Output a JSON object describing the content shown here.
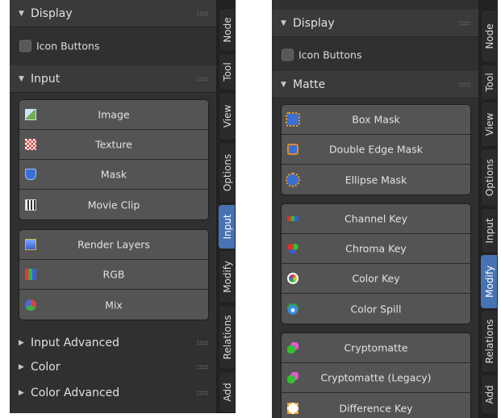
{
  "left": {
    "display_header": "Display",
    "icon_buttons_label": "Icon Buttons",
    "input_header": "Input",
    "group1": [
      {
        "label": "Image",
        "icon": "image-icon"
      },
      {
        "label": "Texture",
        "icon": "texture-icon"
      },
      {
        "label": "Mask",
        "icon": "mask-icon"
      },
      {
        "label": "Movie Clip",
        "icon": "movie-clip-icon"
      }
    ],
    "group2": [
      {
        "label": "Render Layers",
        "icon": "render-layers-icon"
      },
      {
        "label": "RGB",
        "icon": "rgb-icon"
      },
      {
        "label": "Mix",
        "icon": "mix-icon"
      }
    ],
    "collapsed": [
      "Input Advanced",
      "Color",
      "Color Advanced"
    ],
    "tabs": [
      "Node",
      "Tool",
      "View",
      "Options",
      "Input",
      "Modify",
      "Relations",
      "Add"
    ],
    "active_tab": "Input"
  },
  "right": {
    "display_header": "Display",
    "icon_buttons_label": "Icon Buttons",
    "matte_header": "Matte",
    "group1": [
      {
        "label": "Box Mask",
        "icon": "box-mask-icon"
      },
      {
        "label": "Double Edge Mask",
        "icon": "double-edge-mask-icon"
      },
      {
        "label": "Ellipse Mask",
        "icon": "ellipse-mask-icon"
      }
    ],
    "group2": [
      {
        "label": "Channel Key",
        "icon": "channel-key-icon"
      },
      {
        "label": "Chroma Key",
        "icon": "chroma-key-icon"
      },
      {
        "label": "Color Key",
        "icon": "color-key-icon"
      },
      {
        "label": "Color Spill",
        "icon": "color-spill-icon"
      }
    ],
    "group3": [
      {
        "label": "Cryptomatte",
        "icon": "cryptomatte-icon"
      },
      {
        "label": "Cryptomatte (Legacy)",
        "icon": "cryptomatte-legacy-icon"
      },
      {
        "label": "Difference Key",
        "icon": "difference-key-icon"
      }
    ],
    "tabs": [
      "Node",
      "Tool",
      "View",
      "Options",
      "Input",
      "Modify",
      "Relations",
      "Add"
    ],
    "active_tab": "Modify"
  },
  "colors": {
    "active_tab": "#4772b3",
    "panel_bg": "#303030",
    "button_bg": "#545454"
  }
}
